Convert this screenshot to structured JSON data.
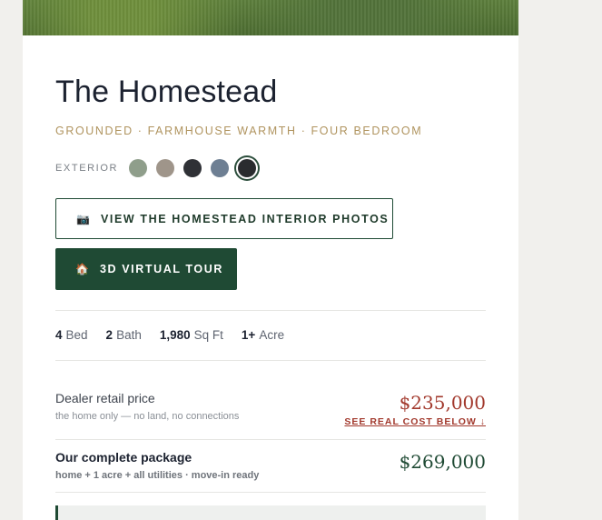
{
  "home": {
    "title": "The Homestead",
    "tagline": "GROUNDED · FARMHOUSE WARMTH · FOUR BEDROOM"
  },
  "exterior": {
    "label": "EXTERIOR",
    "swatches": [
      {
        "name": "sage",
        "color": "#8f9e8b"
      },
      {
        "name": "taupe",
        "color": "#9f958a"
      },
      {
        "name": "charcoal",
        "color": "#2f3136"
      },
      {
        "name": "slate-blue",
        "color": "#6e7f93"
      },
      {
        "name": "black",
        "color": "#2a2c2f",
        "selected": true
      }
    ]
  },
  "buttons": {
    "interior_photos_icon": "📷",
    "interior_photos": "VIEW THE HOMESTEAD INTERIOR PHOTOS",
    "virtual_tour_icon": "🏠",
    "virtual_tour": "3D VIRTUAL TOUR"
  },
  "specs": [
    {
      "value": "4",
      "unit": "Bed"
    },
    {
      "value": "2",
      "unit": "Bath"
    },
    {
      "value": "1,980",
      "unit": "Sq Ft"
    },
    {
      "value": "1+",
      "unit": "Acre"
    }
  ],
  "pricing": {
    "retail_label": "Dealer retail price",
    "retail_sub": "the home only — no land, no connections",
    "retail_price": "$235,000",
    "retail_link": "SEE REAL COST BELOW ↓",
    "package_label": "Our complete package",
    "package_sub": "home + 1 acre + all utilities · move-in ready",
    "package_price": "$269,000"
  },
  "colors": {
    "accent_green": "#1f4a34",
    "price_red": "#a2392d",
    "tagline_gold": "#b0945f"
  }
}
